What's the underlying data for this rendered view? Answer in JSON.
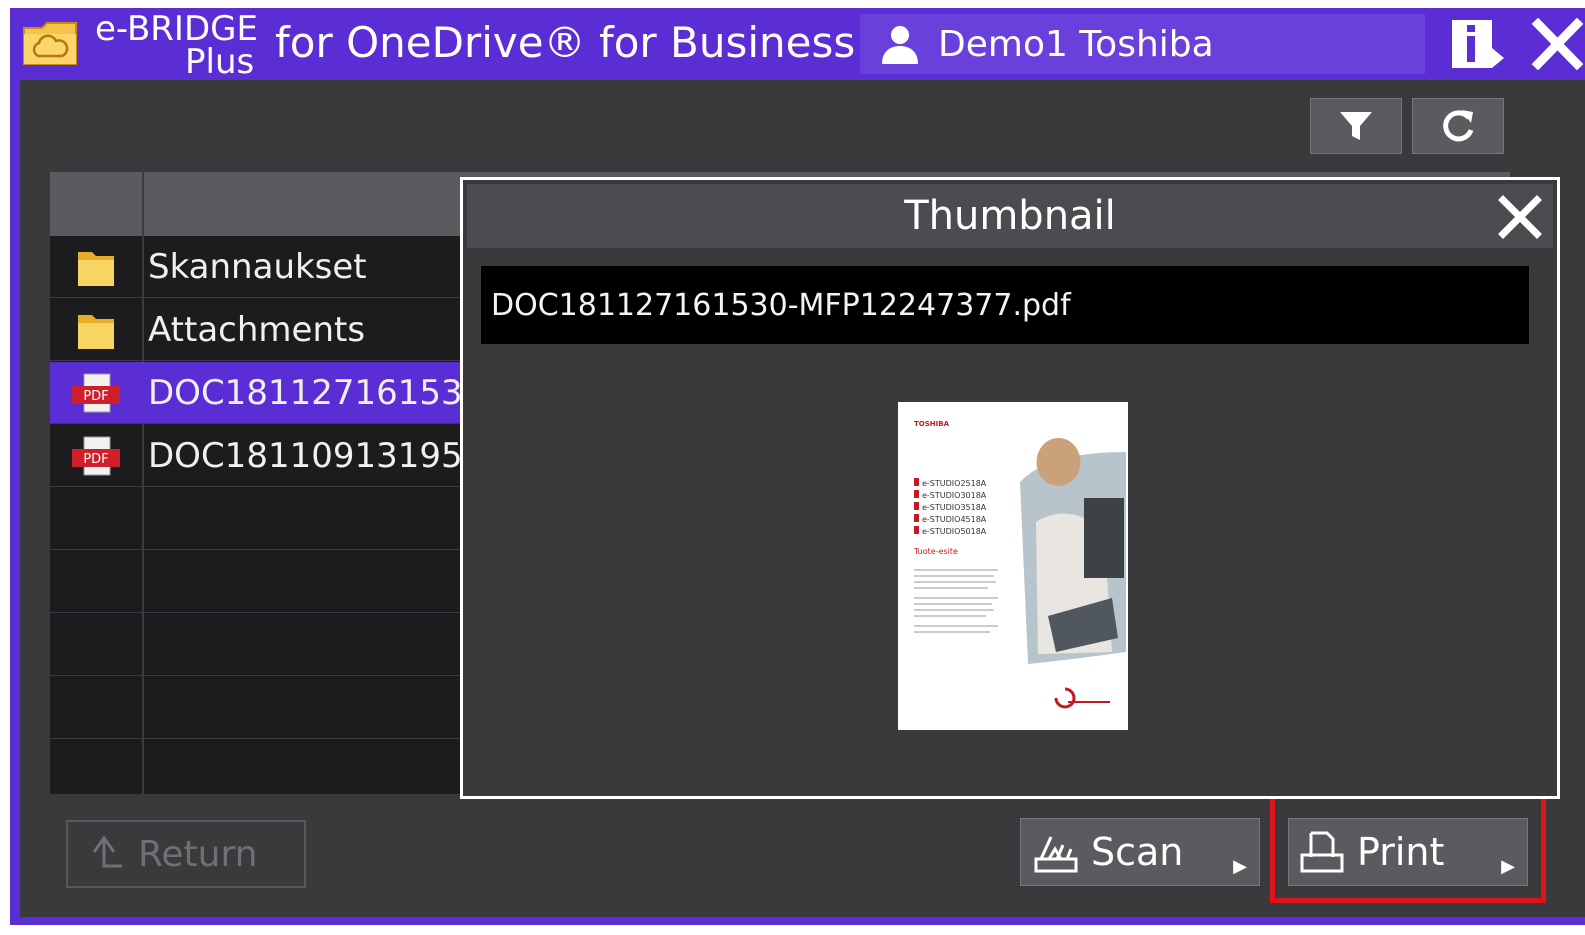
{
  "titlebar": {
    "brand_line1": "e-BRIDGE",
    "brand_line2": "Plus",
    "subtitle": "for OneDrive® for Business",
    "user_name": "Demo1 Toshiba"
  },
  "file_list": {
    "rows": [
      {
        "label": "Skannaukset",
        "icon": "folder-icon",
        "selected": false
      },
      {
        "label": "Attachments",
        "icon": "folder-icon",
        "selected": false
      },
      {
        "label": "DOC18112716153",
        "icon": "pdf-icon",
        "selected": true
      },
      {
        "label": "DOC18110913195",
        "icon": "pdf-icon",
        "selected": false
      }
    ]
  },
  "return_button": {
    "label": "Return"
  },
  "dialog": {
    "title": "Thumbnail",
    "filename": "DOC181127161530-MFP12247377.pdf",
    "preview": {
      "brand": "TOSHIBA",
      "models": [
        "e-STUDIO2518A",
        "e-STUDIO3018A",
        "e-STUDIO3518A",
        "e-STUDIO4518A",
        "e-STUDIO5018A"
      ],
      "heading": "Tuote-esite"
    }
  },
  "actions": {
    "scan_label": "Scan",
    "print_label": "Print"
  },
  "colors": {
    "accent": "#5a2ed4",
    "highlight": "#e0131b",
    "selected_row": "#5a2ed4"
  }
}
